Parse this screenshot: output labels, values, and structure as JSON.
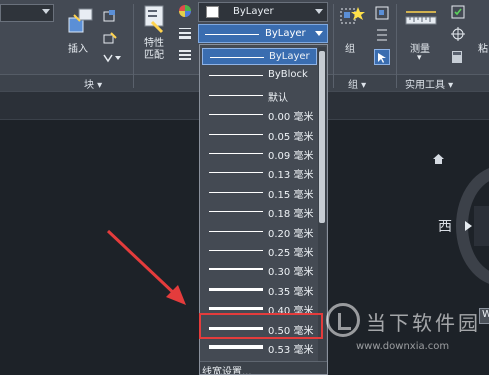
{
  "ribbon": {
    "insert_label": "插入",
    "block_panel_title": "块 ▾",
    "match_props_label": "特性\n匹配",
    "group_label": "组",
    "group_panel_title": "组 ▾",
    "measure_label": "测量",
    "utilities_panel_title": "实用工具 ▾",
    "color_combo_value": "ByLayer",
    "lineweight_combo_value": "ByLayer"
  },
  "lineweight_dropdown": {
    "items": [
      {
        "label": "ByLayer",
        "weight": 1,
        "selected": true
      },
      {
        "label": "ByBlock",
        "weight": 1
      },
      {
        "label": "默认",
        "weight": 1
      },
      {
        "label": "0.00 毫米",
        "weight": 1
      },
      {
        "label": "0.05 毫米",
        "weight": 1
      },
      {
        "label": "0.09 毫米",
        "weight": 1
      },
      {
        "label": "0.13 毫米",
        "weight": 1
      },
      {
        "label": "0.15 毫米",
        "weight": 1
      },
      {
        "label": "0.18 毫米",
        "weight": 1
      },
      {
        "label": "0.20 毫米",
        "weight": 1
      },
      {
        "label": "0.25 毫米",
        "weight": 1
      },
      {
        "label": "0.30 毫米",
        "weight": 2
      },
      {
        "label": "0.35 毫米",
        "weight": 3
      },
      {
        "label": "0.40 毫米",
        "weight": 3
      },
      {
        "label": "0.50 毫米",
        "weight": 3
      },
      {
        "label": "0.53 毫米",
        "weight": 4
      }
    ],
    "footer": "线宽设置..."
  },
  "viewcube": {
    "west_label": "西",
    "w_button": "W"
  },
  "watermark": {
    "title": "当下软件园",
    "url": "www.downxia.com"
  },
  "colors": {
    "highlight": "#e43c3c",
    "selected_bg": "#3a6db0",
    "arrow": "#e43c3c"
  }
}
